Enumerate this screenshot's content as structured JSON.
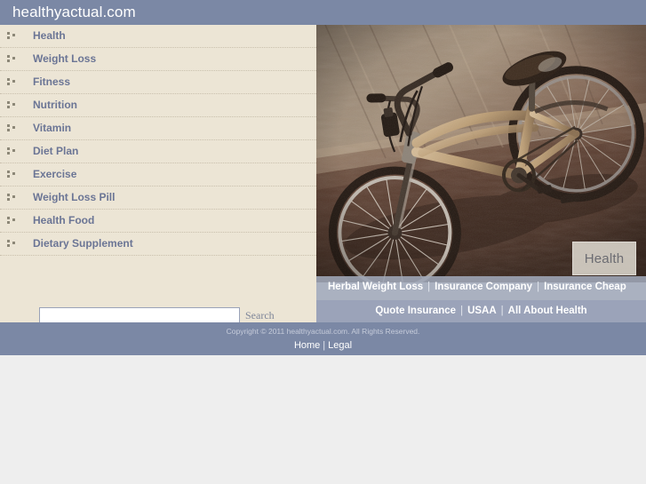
{
  "header": {
    "site_title": "healthyactual.com",
    "bg_color": "#7b88a5"
  },
  "sidebar": {
    "bg_color": "#ece5d5",
    "items": [
      {
        "label": "Health",
        "icon": "bullet-squares-icon"
      },
      {
        "label": "Weight Loss",
        "icon": "bullet-squares-icon"
      },
      {
        "label": "Fitness",
        "icon": "bullet-squares-icon"
      },
      {
        "label": "Nutrition",
        "icon": "bullet-squares-icon"
      },
      {
        "label": "Vitamin",
        "icon": "bullet-squares-icon"
      },
      {
        "label": "Diet Plan",
        "icon": "bullet-squares-icon"
      },
      {
        "label": "Exercise",
        "icon": "bullet-squares-icon"
      },
      {
        "label": "Weight Loss Pill",
        "icon": "bullet-squares-icon"
      },
      {
        "label": "Health Food",
        "icon": "bullet-squares-icon"
      },
      {
        "label": "Dietary Supplement",
        "icon": "bullet-squares-icon"
      }
    ],
    "search": {
      "value": "",
      "placeholder": "",
      "button_label": "Search"
    }
  },
  "content": {
    "photo": {
      "alt": "bicycle leaning against concrete wall",
      "badge_label": "Health"
    },
    "linkbar_top": {
      "links": [
        "Herbal Weight Loss",
        "Insurance Company",
        "Insurance Cheap"
      ],
      "separator": "|"
    },
    "linkbar_bottom": {
      "links": [
        "Quote Insurance",
        "USAA",
        "All About Health"
      ],
      "separator": "|"
    }
  },
  "footer": {
    "copyright": "Copyright © 2011 healthyactual.com. All Rights Reserved.",
    "links": [
      "Home",
      "Legal"
    ],
    "separator": "|",
    "bg_color": "#7b88a5"
  }
}
